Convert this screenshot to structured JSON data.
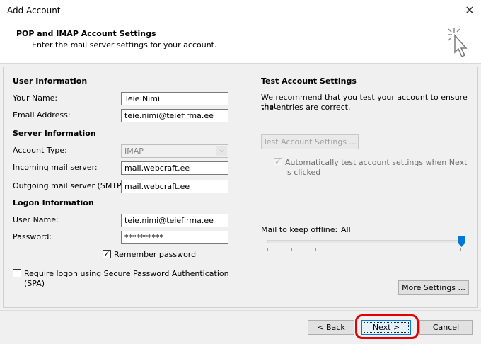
{
  "window": {
    "title": "Add Account"
  },
  "header": {
    "title": "POP and IMAP Account Settings",
    "subtitle": "Enter the mail server settings for your account."
  },
  "user_info": {
    "heading": "User Information",
    "name_label": "Your Name:",
    "name_value": "Teie Nimi",
    "email_label": "Email Address:",
    "email_value": "teie.nimi@teiefirma.ee"
  },
  "server_info": {
    "heading": "Server Information",
    "account_type_label": "Account Type:",
    "account_type_value": "IMAP",
    "incoming_label": "Incoming mail server:",
    "incoming_value": "mail.webcraft.ee",
    "outgoing_label": "Outgoing mail server (SMTP):",
    "outgoing_value": "mail.webcraft.ee"
  },
  "logon_info": {
    "heading": "Logon Information",
    "username_label": "User Name:",
    "username_value": "teie.nimi@teiefirma.ee",
    "password_label": "Password:",
    "password_value": "**********",
    "remember_label": "Remember password",
    "remember_checked": true,
    "spa_label_line1": "Require logon using Secure Password Authentication",
    "spa_label_line2": "(SPA)",
    "spa_checked": false
  },
  "test_settings": {
    "heading": "Test Account Settings",
    "desc_line1": "We recommend that you test your account to ensure that",
    "desc_line2": "the entries are correct.",
    "test_button": "Test Account Settings ...",
    "auto_test_line1": "Automatically test account settings when Next",
    "auto_test_line2": "is clicked",
    "auto_test_checked": true
  },
  "offline": {
    "label": "Mail to keep offline:",
    "value": "All",
    "slider_fraction": 1.0
  },
  "more_settings_button": "More Settings ...",
  "footer": {
    "back_button": "< Back",
    "next_button": "Next >",
    "cancel_button": "Cancel"
  },
  "colors": {
    "highlight_ring": "#e20000",
    "accent": "#0078d7"
  }
}
